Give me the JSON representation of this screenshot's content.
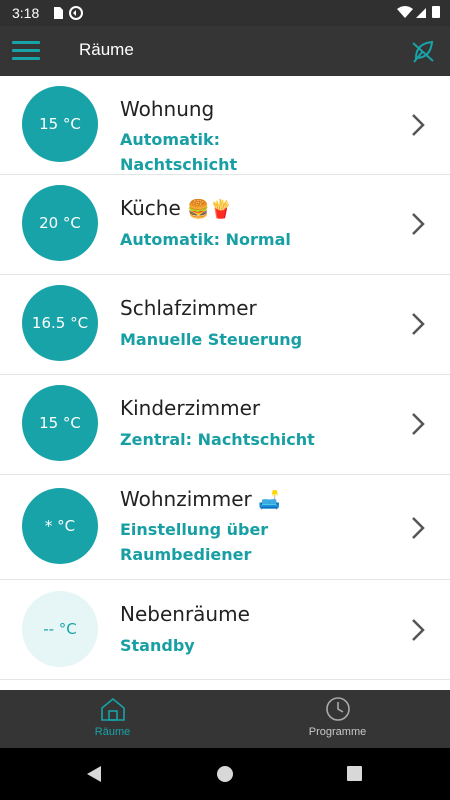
{
  "status_bar": {
    "time": "3:18"
  },
  "app_bar": {
    "title": "Räume",
    "menu_icon": "hamburger-menu-icon",
    "action_icon": "leaf-off-icon",
    "accent": "#17a3a8"
  },
  "rooms": [
    {
      "temp": "15 °C",
      "name": "Wohnung",
      "emoji": "",
      "mode": "Automatik: Nachtschicht",
      "active": true
    },
    {
      "temp": "20 °C",
      "name": "Küche",
      "emoji": "🍔🍟",
      "mode": "Automatik: Normal",
      "active": true
    },
    {
      "temp": "16.5 °C",
      "name": "Schlafzimmer",
      "emoji": "",
      "mode": "Manuelle Steuerung",
      "active": true
    },
    {
      "temp": "15 °C",
      "name": "Kinderzimmer",
      "emoji": "",
      "mode": "Zentral: Nachtschicht",
      "active": true
    },
    {
      "temp": "* °C",
      "name": "Wohnzimmer",
      "emoji": "🛋️",
      "mode": "Einstellung über Raumbediener",
      "active": true
    },
    {
      "temp": "-- °C",
      "name": "Nebenräume",
      "emoji": "",
      "mode": "Standby",
      "active": false
    }
  ],
  "bottom_nav": {
    "tabs": [
      {
        "label": "Räume",
        "icon": "house-icon",
        "selected": true
      },
      {
        "label": "Programme",
        "icon": "clock-icon",
        "selected": false
      }
    ]
  }
}
